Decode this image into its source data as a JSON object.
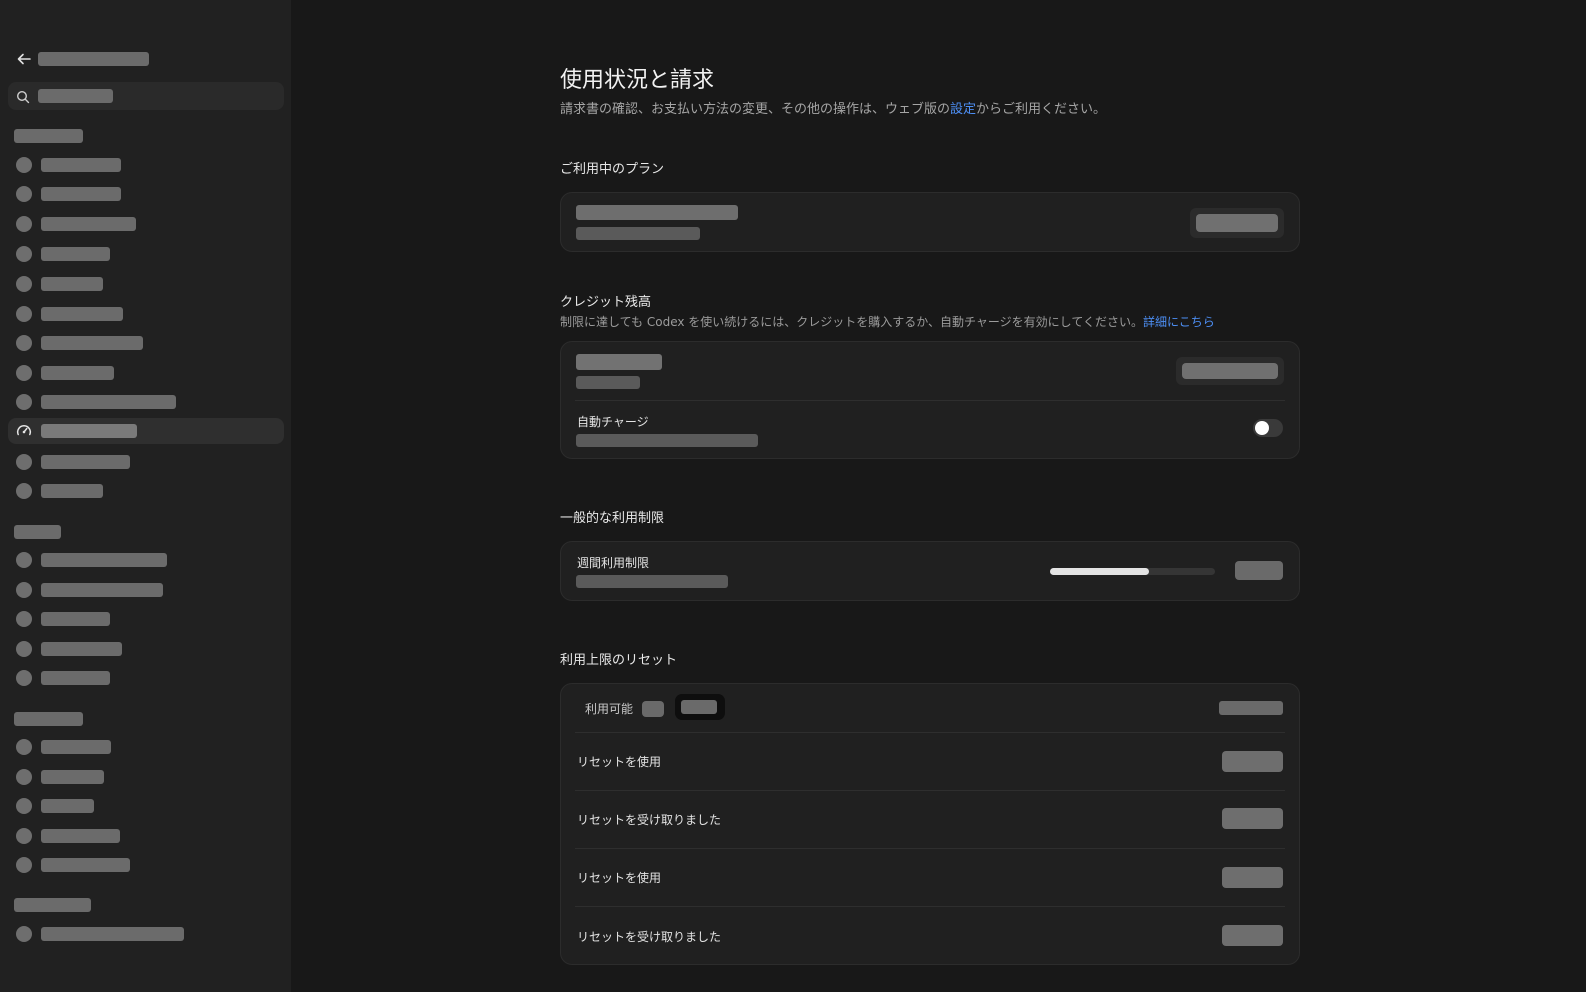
{
  "page": {
    "title": "使用状況と請求",
    "subtitle_before": "請求書の確認、お支払い方法の変更、その他の操作は、ウェブ版の",
    "subtitle_link": "設定",
    "subtitle_after": "からご利用ください。"
  },
  "plan": {
    "title": "ご利用中のプラン"
  },
  "credits": {
    "title": "クレジット残高",
    "desc_before": "制限に達しても Codex を使い続けるには、クレジットを購入するか、自動チャージを有効にしてください。",
    "desc_link": "詳細にこちら",
    "auto_charge_label": "自動チャージ",
    "auto_charge_enabled": false
  },
  "limits": {
    "title": "一般的な利用制限",
    "weekly_label": "週間利用制限",
    "weekly_used_fraction": 0.6
  },
  "resets": {
    "title": "利用上限のリセット",
    "available_label": "利用可能",
    "rows": [
      {
        "label": "リセットを使用"
      },
      {
        "label": "リセットを受け取りました"
      },
      {
        "label": "リセットを使用"
      },
      {
        "label": "リセットを受け取りました"
      }
    ]
  },
  "colors": {
    "accent": "#4d8ff5",
    "background": "#181818",
    "sidebar": "#212121"
  },
  "icons": {
    "back": "arrow-left-icon",
    "search": "search-icon",
    "active_item": "gauge-icon"
  }
}
